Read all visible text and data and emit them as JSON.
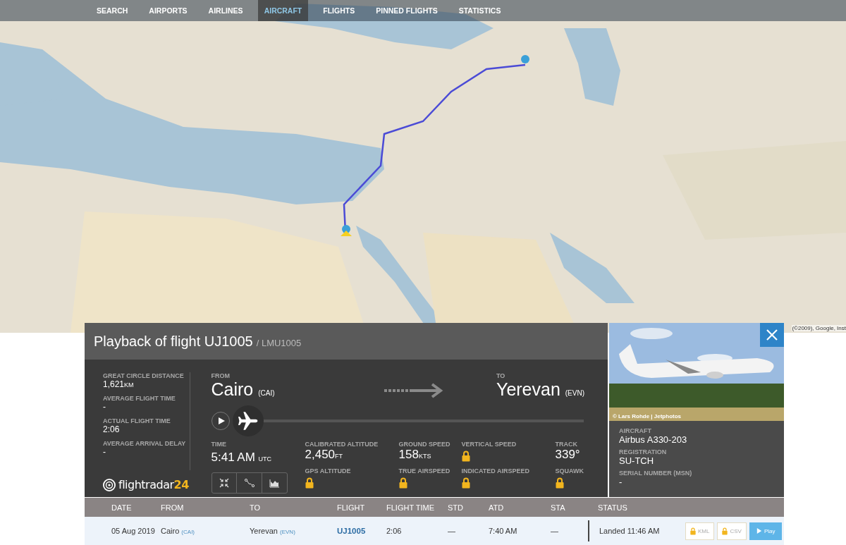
{
  "nav": [
    {
      "label": "SEARCH",
      "selected": false
    },
    {
      "label": "AIRPORTS",
      "selected": false
    },
    {
      "label": "AIRLINES",
      "selected": false
    },
    {
      "label": "AIRCRAFT",
      "selected": true
    },
    {
      "label": "FLIGHTS",
      "selected": false
    },
    {
      "label": "PINNED FLIGHTS",
      "selected": false
    },
    {
      "label": "STATISTICS",
      "selected": false
    }
  ],
  "map_attribution": "(©2009), Google, Inst",
  "panel": {
    "title": "Playback of flight UJ1005",
    "subtitle": "/ LMU1005"
  },
  "stats": [
    {
      "label": "GREAT CIRCLE DISTANCE",
      "value": "1,621",
      "unit": "KM"
    },
    {
      "label": "AVERAGE FLIGHT TIME",
      "value": "-"
    },
    {
      "label": "ACTUAL FLIGHT TIME",
      "value": "2:06"
    },
    {
      "label": "AVERAGE ARRIVAL DELAY",
      "value": "-"
    }
  ],
  "logo": {
    "text": "flightradar",
    "accent": "24"
  },
  "route": {
    "from": {
      "label": "FROM",
      "city": "Cairo",
      "code": "(CAI)"
    },
    "to": {
      "label": "TO",
      "city": "Yerevan",
      "code": "(EVN)"
    }
  },
  "playback": {
    "level": 0
  },
  "time": {
    "label": "TIME",
    "value": "5:41 AM",
    "unit": "UTC"
  },
  "metric_columns": [
    [
      {
        "label": "CALIBRATED ALTITUDE",
        "value": "2,450",
        "unit": "FT",
        "locked": false
      },
      {
        "label": "GPS ALTITUDE",
        "locked": true
      }
    ],
    [
      {
        "label": "GROUND SPEED",
        "value": "158",
        "unit": "KTS",
        "locked": false
      },
      {
        "label": "TRUE AIRSPEED",
        "locked": true
      }
    ],
    [
      {
        "label": "VERTICAL SPEED",
        "locked": true
      },
      {
        "label": "INDICATED AIRSPEED",
        "locked": true
      }
    ],
    [
      {
        "label": "TRACK",
        "value": "339°",
        "locked": false
      },
      {
        "label": "SQUAWK",
        "locked": true
      }
    ]
  ],
  "aircraft": {
    "photo_credit": "© Lars Rohde | Jetphotos",
    "fields": [
      {
        "label": "AIRCRAFT",
        "value": "Airbus A330-203"
      },
      {
        "label": "REGISTRATION",
        "value": "SU-TCH"
      },
      {
        "label": "SERIAL NUMBER (MSN)",
        "value": "-"
      }
    ]
  },
  "table": {
    "columns": [
      "DATE",
      "FROM",
      "TO",
      "FLIGHT",
      "FLIGHT TIME",
      "STD",
      "ATD",
      "STA",
      "STATUS"
    ],
    "rows": [
      {
        "date": "05 Aug 2019",
        "from": "Cairo",
        "from_code": "(CAI)",
        "to": "Yerevan",
        "to_code": "(EVN)",
        "flight": "UJ1005",
        "flight_time": "2:06",
        "std": "—",
        "atd": "7:40 AM",
        "sta": "—",
        "status": "Landed 11:46 AM",
        "actions": [
          {
            "kind": "locked",
            "label": "KML"
          },
          {
            "kind": "locked",
            "label": "CSV"
          },
          {
            "kind": "play",
            "label": "Play"
          }
        ]
      }
    ]
  }
}
